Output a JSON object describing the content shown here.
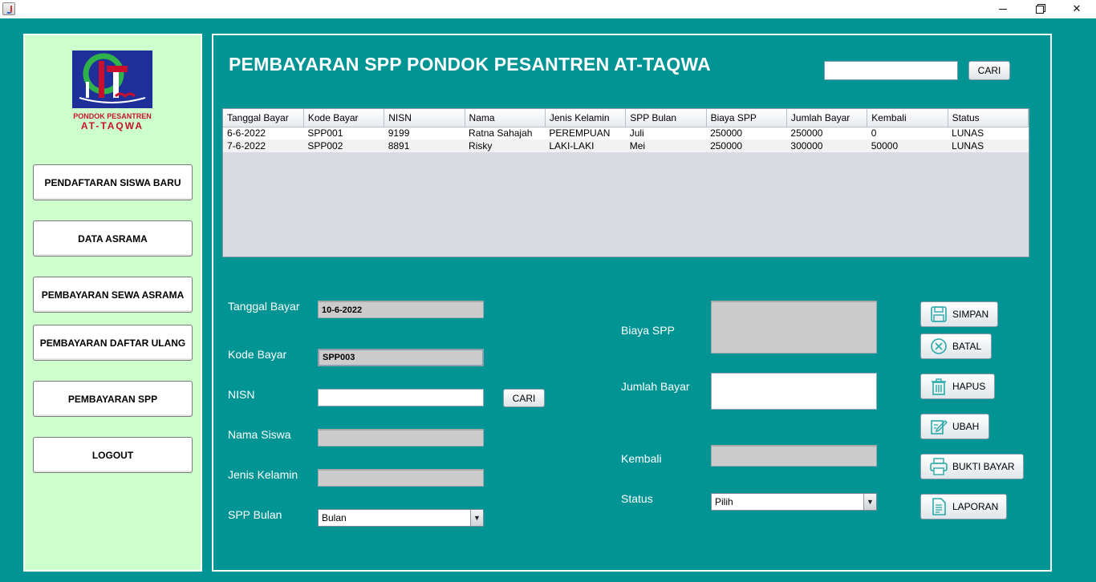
{
  "titlebar": {
    "min_label": "",
    "max_label": "",
    "close_label": "✕"
  },
  "logo": {
    "line1": "PONDOK PESANTREN",
    "line2": "AT-TAQWA"
  },
  "sidebar": {
    "items": [
      {
        "label": "PENDAFTARAN SISWA BARU"
      },
      {
        "label": "DATA ASRAMA"
      },
      {
        "label": "PEMBAYARAN SEWA ASRAMA"
      },
      {
        "label": "PEMBAYARAN DAFTAR ULANG"
      },
      {
        "label": "PEMBAYARAN SPP"
      },
      {
        "label": "LOGOUT"
      }
    ]
  },
  "header": {
    "title": "PEMBAYARAN SPP PONDOK PESANTREN AT-TAQWA",
    "search_value": "",
    "search_button": "CARI"
  },
  "table": {
    "columns": [
      "Tanggal Bayar",
      "Kode Bayar",
      "NISN",
      "Nama",
      "Jenis Kelamin",
      "SPP Bulan",
      "Biaya SPP",
      "Jumlah Bayar",
      "Kembali",
      "Status"
    ],
    "rows": [
      [
        "6-6-2022",
        "SPP001",
        "9199",
        "Ratna Sahajah",
        "PEREMPUAN",
        "Juli",
        "250000",
        "250000",
        "0",
        "LUNAS"
      ],
      [
        "7-6-2022",
        "SPP002",
        "8891",
        "Risky",
        "LAKI-LAKI",
        "Mei",
        "250000",
        "300000",
        "50000",
        "LUNAS"
      ]
    ]
  },
  "form": {
    "tanggal_label": "Tanggal Bayar",
    "tanggal_value": "10-6-2022",
    "kode_label": "Kode Bayar",
    "kode_value": "SPP003",
    "nisn_label": "NISN",
    "nisn_value": "",
    "nisn_button": "CARI",
    "nama_label": "Nama Siswa",
    "nama_value": "",
    "jk_label": "Jenis Kelamin",
    "jk_value": "",
    "bulan_label": "SPP Bulan",
    "bulan_value": "Bulan",
    "biaya_label": "Biaya SPP",
    "biaya_value": "",
    "jumlah_label": "Jumlah Bayar",
    "jumlah_value": "",
    "kembali_label": "Kembali",
    "kembali_value": "",
    "status_label": "Status",
    "status_value": "Pilih"
  },
  "actions": {
    "simpan": "SIMPAN",
    "batal": "BATAL",
    "hapus": "HAPUS",
    "ubah": "UBAH",
    "bukti": "BUKTI BAYAR",
    "laporan": "LAPORAN"
  },
  "colors": {
    "background": "#009494",
    "sidebar": "#ccffcc",
    "readonly_field": "#cccccc",
    "icon_teal": "#2aa9a9"
  }
}
